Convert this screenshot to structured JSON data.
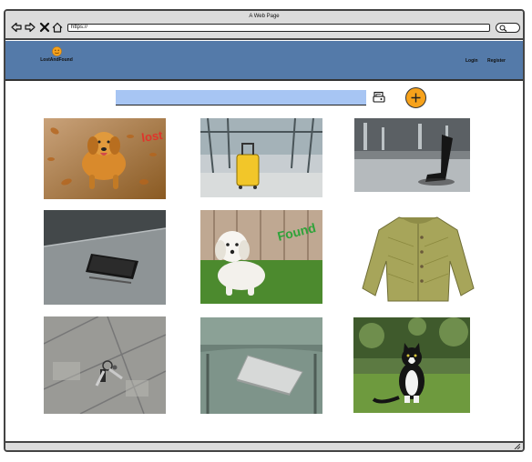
{
  "window": {
    "title": "A Web Page",
    "url": "https://"
  },
  "header": {
    "logo_text": "LostAndFound",
    "links": [
      {
        "label": "Login"
      },
      {
        "label": "Register"
      }
    ]
  },
  "search": {
    "value": ""
  },
  "items": [
    {
      "subject": "golden retriever dog running",
      "overlay_text": "lost"
    },
    {
      "subject": "yellow suitcase",
      "overlay_text": ""
    },
    {
      "subject": "black folding chair",
      "overlay_text": ""
    },
    {
      "subject": "smartphone on table",
      "overlay_text": ""
    },
    {
      "subject": "white puppy",
      "overlay_text": "Found"
    },
    {
      "subject": "olive jacket",
      "overlay_text": ""
    },
    {
      "subject": "keys on pavement",
      "overlay_text": ""
    },
    {
      "subject": "laptop on chair",
      "overlay_text": ""
    },
    {
      "subject": "black and white cat",
      "overlay_text": ""
    }
  ],
  "colors": {
    "header_bg": "#547aa9",
    "search_bg": "#a7c5f3",
    "accent": "#f7a21b",
    "lost_text": "#e0342b",
    "found_text": "#2fa33a"
  }
}
